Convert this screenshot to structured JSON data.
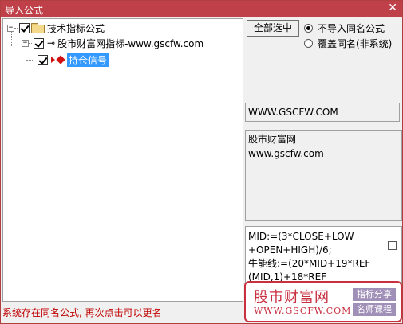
{
  "window": {
    "title": "导入公式",
    "close_glyph": "✕"
  },
  "tree": {
    "root": {
      "label": "技术指标公式",
      "expander": "−"
    },
    "group": {
      "label": "股市财富网指标-www.gscfw.com",
      "expander": "−",
      "icon": "key-icon"
    },
    "item": {
      "label": "持仓信号",
      "selected": true
    }
  },
  "actions": {
    "select_all_label": "全部选中",
    "option_skip_label": "不导入同名公式",
    "option_overwrite_label": "覆盖同名(非系统)",
    "selected_option": "skip"
  },
  "info": {
    "website": "WWW.GSCFW.COM",
    "description_lines": [
      "股市财富网",
      "www.gscfw.com"
    ],
    "formula_lines": [
      "MID:=(3*CLOSE+LOW",
      "+OPEN+HIGH)/6;",
      "牛能线:=(20*MID+19*REF",
      "(MID,1)+18*REF"
    ]
  },
  "status_text": "系统存在同名公式, 再次点击可以更名",
  "watermark": {
    "brand": "股市财富网",
    "domain": "WWW.GSCFW.COM",
    "tag_top": "指标分享",
    "tag_bottom": "名师课程",
    "color": "#c83040"
  }
}
